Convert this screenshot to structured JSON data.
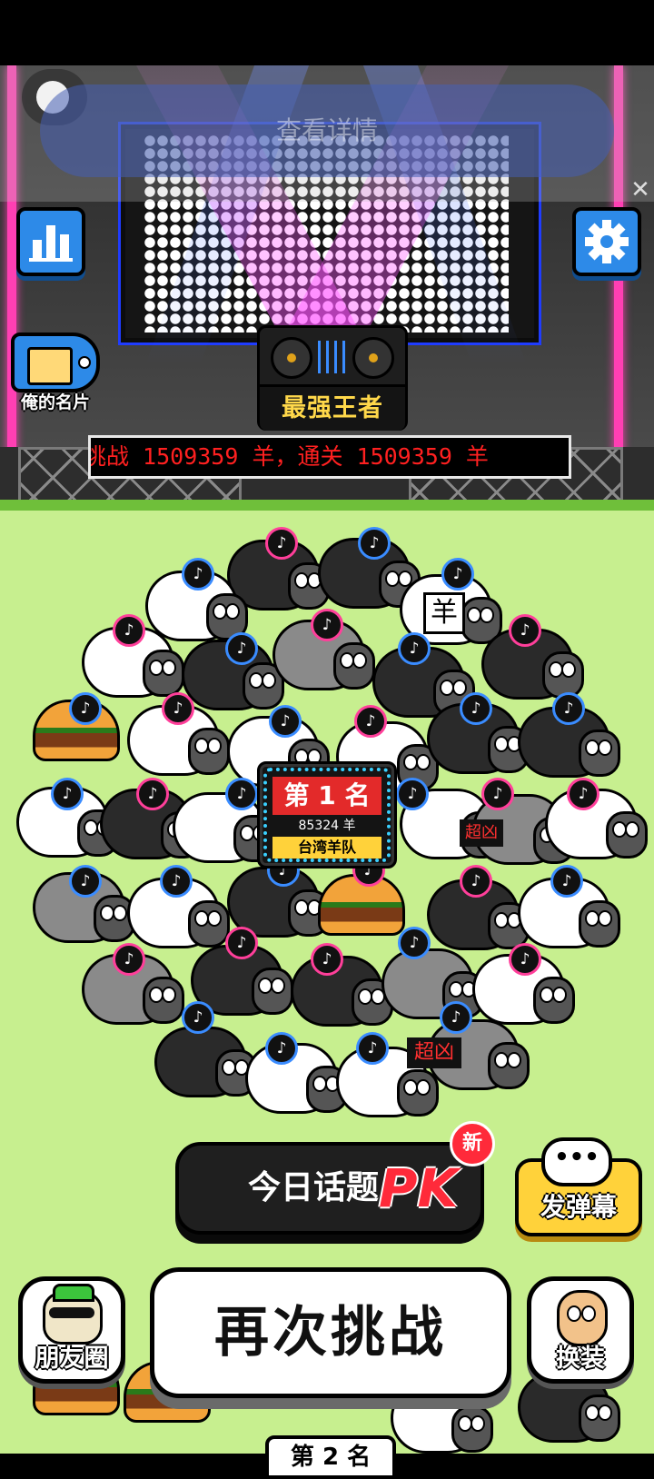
{
  "overlay": {
    "detail_label": "查看详情",
    "close_symbol": "✕"
  },
  "stage": {
    "dj_plate_label": "最强王者",
    "ticker_text": "挑战 1509359 羊，通关 1509359 羊"
  },
  "side_buttons": {
    "card_label": "俺的名片"
  },
  "rank_card": {
    "title": "第 1 名",
    "score": "85324 羊",
    "team": "台湾羊队"
  },
  "controls": {
    "pk_label": "今日话题",
    "pk_mark": "PK",
    "new_badge": "新",
    "danmu_bubble": "•••",
    "danmu_label": "发弹幕",
    "retry_label": "再次挑战",
    "moments_label": "朋友圈",
    "dress_label": "换装",
    "rank2_label": "第 2 名"
  },
  "field_signs": {
    "sheep_sign": "羊",
    "super_fierce": "超凶"
  },
  "colors": {
    "accent_blue": "#2d8ae8",
    "grass": "#c7ef8f",
    "rank_red": "#e32a2a",
    "pk_red": "#ff2a3a",
    "ticker_red": "#ff2020"
  },
  "icons": {
    "stats": "bar-chart-icon",
    "settings": "gear-icon",
    "tiktok": "tiktok-badge-icon"
  }
}
